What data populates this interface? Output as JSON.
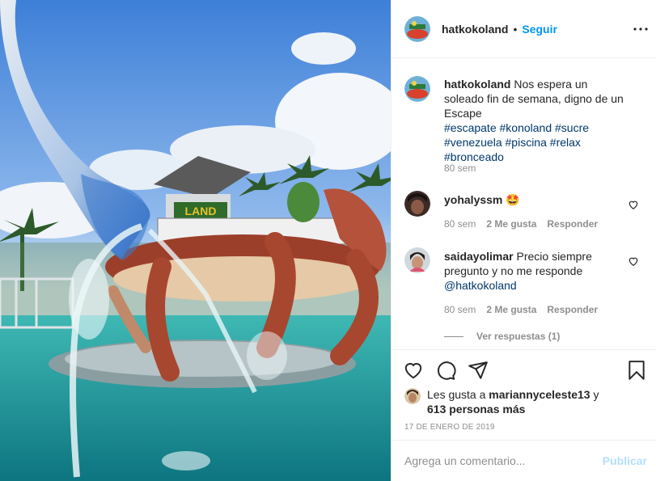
{
  "post": {
    "username": "hatkokoland",
    "separator": "•",
    "follow_label": "Seguir",
    "caption": {
      "username": "hatkokoland",
      "text": "Nos espera un soleado fin de semana, digno de un Escape",
      "hashtags": [
        "#escapate",
        "#konoland",
        "#sucre",
        "#venezuela",
        "#piscina",
        "#relax",
        "#bronceado"
      ],
      "age": "80 sem"
    },
    "comments": [
      {
        "username": "yohalyssm",
        "text": "🤩",
        "age": "80 sem",
        "likes": "2 Me gusta",
        "reply": "Responder"
      },
      {
        "username": "saidayolimar",
        "text": "Precio siempre pregunto y no me responde",
        "mention": "@hatkokoland",
        "age": "80 sem",
        "likes": "2 Me gusta",
        "reply": "Responder",
        "view_replies": "Ver respuestas (1)"
      }
    ],
    "likes_line": {
      "prefix": "Les gusta a",
      "user": "mariannyceleste13",
      "joiner": "y",
      "others": "613 personas más"
    },
    "date": "17 DE ENERO DE 2019",
    "comment_placeholder": "Agrega un comentario...",
    "publish_label": "Publicar"
  },
  "icons": {
    "more": "more-horizontal-icon",
    "heart": "heart-icon",
    "comment": "comment-icon",
    "share": "share-icon",
    "save": "bookmark-icon"
  },
  "colors": {
    "follow": "#0095f6",
    "hashtag": "#00376b",
    "muted": "#8e8e8e",
    "publish_disabled": "#b2dffc"
  }
}
